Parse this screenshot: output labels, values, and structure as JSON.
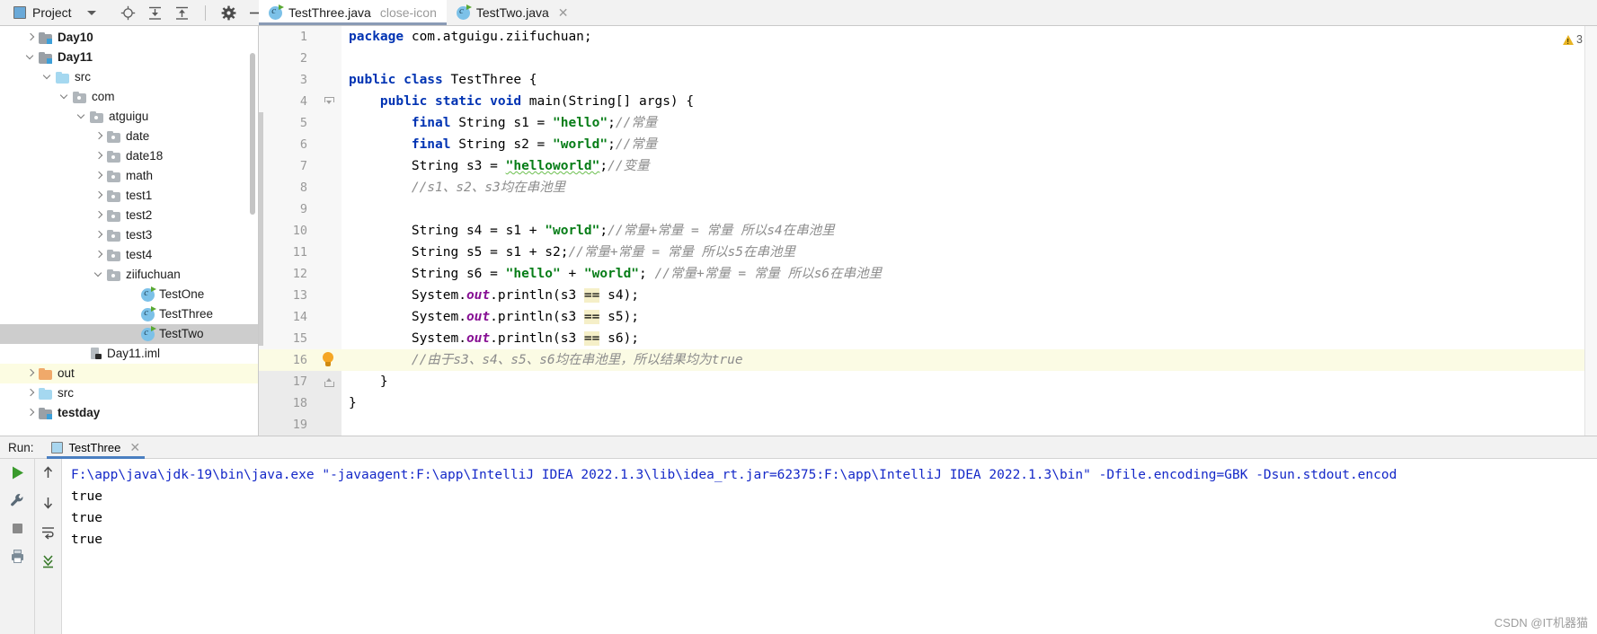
{
  "toolbar": {
    "project_label": "Project",
    "project_icon": "project-panel-icon",
    "dropdown_icon": "chevron-down-icon",
    "icons": [
      {
        "name": "locate-target-icon"
      },
      {
        "name": "expand-all-icon"
      },
      {
        "name": "collapse-all-icon"
      },
      {
        "name": "settings-gear-icon"
      },
      {
        "name": "hide-minimize-icon"
      }
    ]
  },
  "tabs": [
    {
      "label": "TestThree.java",
      "icon": "java-class-icon",
      "active": true,
      "close_icon": "close-icon"
    },
    {
      "label": "TestTwo.java",
      "icon": "java-class-icon",
      "active": false,
      "close_icon": "close-icon"
    }
  ],
  "tree": [
    {
      "label": "Day10",
      "indent": 1,
      "arrow": "right",
      "icon": "module",
      "bold": true,
      "state": "none"
    },
    {
      "label": "Day11",
      "indent": 1,
      "arrow": "down",
      "icon": "module",
      "bold": true,
      "state": "none"
    },
    {
      "label": "src",
      "indent": 2,
      "arrow": "down",
      "icon": "source",
      "bold": false,
      "state": "none"
    },
    {
      "label": "com",
      "indent": 3,
      "arrow": "down",
      "icon": "package",
      "bold": false,
      "state": "none"
    },
    {
      "label": "atguigu",
      "indent": 4,
      "arrow": "down",
      "icon": "package",
      "bold": false,
      "state": "none"
    },
    {
      "label": "date",
      "indent": 5,
      "arrow": "right",
      "icon": "package",
      "bold": false,
      "state": "none"
    },
    {
      "label": "date18",
      "indent": 5,
      "arrow": "right",
      "icon": "package",
      "bold": false,
      "state": "none"
    },
    {
      "label": "math",
      "indent": 5,
      "arrow": "right",
      "icon": "package",
      "bold": false,
      "state": "none"
    },
    {
      "label": "test1",
      "indent": 5,
      "arrow": "right",
      "icon": "package",
      "bold": false,
      "state": "none"
    },
    {
      "label": "test2",
      "indent": 5,
      "arrow": "right",
      "icon": "package",
      "bold": false,
      "state": "none"
    },
    {
      "label": "test3",
      "indent": 5,
      "arrow": "right",
      "icon": "package",
      "bold": false,
      "state": "none"
    },
    {
      "label": "test4",
      "indent": 5,
      "arrow": "right",
      "icon": "package",
      "bold": false,
      "state": "none"
    },
    {
      "label": "ziifuchuan",
      "indent": 5,
      "arrow": "down",
      "icon": "package",
      "bold": false,
      "state": "none"
    },
    {
      "label": "TestOne",
      "indent": 7,
      "arrow": "none",
      "icon": "class",
      "bold": false,
      "state": "none"
    },
    {
      "label": "TestThree",
      "indent": 7,
      "arrow": "none",
      "icon": "class",
      "bold": false,
      "state": "none"
    },
    {
      "label": "TestTwo",
      "indent": 7,
      "arrow": "none",
      "icon": "class",
      "bold": false,
      "state": "selected"
    },
    {
      "label": "Day11.iml",
      "indent": 4,
      "arrow": "none",
      "icon": "iml",
      "bold": false,
      "state": "none"
    },
    {
      "label": "out",
      "indent": 1,
      "arrow": "right",
      "icon": "output",
      "bold": false,
      "state": "highlight"
    },
    {
      "label": "src",
      "indent": 1,
      "arrow": "right",
      "icon": "source",
      "bold": false,
      "state": "none"
    },
    {
      "label": "testday",
      "indent": 1,
      "arrow": "right",
      "icon": "module",
      "bold": true,
      "state": "none"
    }
  ],
  "editor": {
    "warning_count": "3",
    "warning_icon": "warning-triangle-icon",
    "lines": [
      {
        "num": "1",
        "segments": [
          {
            "t": "package ",
            "c": "kw"
          },
          {
            "t": "com.atguigu.ziifuchuan;",
            "c": ""
          }
        ],
        "indent": 0,
        "run": false,
        "fold": "none",
        "bulb": false,
        "highlight": false
      },
      {
        "num": "2",
        "segments": [],
        "indent": 0,
        "run": false,
        "fold": "none",
        "bulb": false,
        "highlight": false
      },
      {
        "num": "3",
        "segments": [
          {
            "t": "public class ",
            "c": "kw"
          },
          {
            "t": "TestThree {",
            "c": ""
          }
        ],
        "indent": 0,
        "run": true,
        "fold": "none",
        "bulb": false,
        "highlight": false
      },
      {
        "num": "4",
        "segments": [
          {
            "t": "    ",
            "c": ""
          },
          {
            "t": "public static void ",
            "c": "kw"
          },
          {
            "t": "main(String[] args) {",
            "c": ""
          }
        ],
        "indent": 0,
        "run": true,
        "fold": "down",
        "bulb": false,
        "highlight": false
      },
      {
        "num": "5",
        "segments": [
          {
            "t": "        ",
            "c": ""
          },
          {
            "t": "final ",
            "c": "kw"
          },
          {
            "t": "String s1 = ",
            "c": ""
          },
          {
            "t": "\"hello\"",
            "c": "str"
          },
          {
            "t": ";",
            "c": ""
          },
          {
            "t": "//常量",
            "c": "cmt"
          }
        ],
        "indent": 0,
        "run": false,
        "fold": "none",
        "bulb": false,
        "highlight": false
      },
      {
        "num": "6",
        "segments": [
          {
            "t": "        ",
            "c": ""
          },
          {
            "t": "final ",
            "c": "kw"
          },
          {
            "t": "String s2 = ",
            "c": ""
          },
          {
            "t": "\"world\"",
            "c": "str"
          },
          {
            "t": ";",
            "c": ""
          },
          {
            "t": "//常量",
            "c": "cmt"
          }
        ],
        "indent": 0,
        "run": false,
        "fold": "none",
        "bulb": false,
        "highlight": false
      },
      {
        "num": "7",
        "segments": [
          {
            "t": "        String s3 = ",
            "c": ""
          },
          {
            "t": "\"helloworld\"",
            "c": "str wavy"
          },
          {
            "t": ";",
            "c": ""
          },
          {
            "t": "//变量",
            "c": "cmt"
          }
        ],
        "indent": 0,
        "run": false,
        "fold": "none",
        "bulb": false,
        "highlight": false
      },
      {
        "num": "8",
        "segments": [
          {
            "t": "        ",
            "c": ""
          },
          {
            "t": "//s1、s2、s3均在串池里",
            "c": "cmt"
          }
        ],
        "indent": 0,
        "run": false,
        "fold": "none",
        "bulb": false,
        "highlight": false
      },
      {
        "num": "9",
        "segments": [],
        "indent": 0,
        "run": false,
        "fold": "none",
        "bulb": false,
        "highlight": false
      },
      {
        "num": "10",
        "segments": [
          {
            "t": "        String s4 = s1 + ",
            "c": ""
          },
          {
            "t": "\"world\"",
            "c": "str"
          },
          {
            "t": ";",
            "c": ""
          },
          {
            "t": "//常量+常量 = 常量 所以s4在串池里",
            "c": "cmt"
          }
        ],
        "indent": 0,
        "run": false,
        "fold": "none",
        "bulb": false,
        "highlight": false
      },
      {
        "num": "11",
        "segments": [
          {
            "t": "        String s5 = s1 + s2;",
            "c": ""
          },
          {
            "t": "//常量+常量 = 常量 所以s5在串池里",
            "c": "cmt"
          }
        ],
        "indent": 0,
        "run": false,
        "fold": "none",
        "bulb": false,
        "highlight": false
      },
      {
        "num": "12",
        "segments": [
          {
            "t": "        String s6 = ",
            "c": ""
          },
          {
            "t": "\"hello\"",
            "c": "str"
          },
          {
            "t": " + ",
            "c": ""
          },
          {
            "t": "\"world\"",
            "c": "str"
          },
          {
            "t": "; ",
            "c": ""
          },
          {
            "t": "//常量+常量 = 常量 所以s6在串池里",
            "c": "cmt"
          }
        ],
        "indent": 0,
        "run": false,
        "fold": "none",
        "bulb": false,
        "highlight": false
      },
      {
        "num": "13",
        "segments": [
          {
            "t": "        System.",
            "c": ""
          },
          {
            "t": "out",
            "c": "fld"
          },
          {
            "t": ".println(s3 ",
            "c": ""
          },
          {
            "t": "==",
            "c": "op-hl"
          },
          {
            "t": " s4);",
            "c": ""
          }
        ],
        "indent": 0,
        "run": false,
        "fold": "none",
        "bulb": false,
        "highlight": false
      },
      {
        "num": "14",
        "segments": [
          {
            "t": "        System.",
            "c": ""
          },
          {
            "t": "out",
            "c": "fld"
          },
          {
            "t": ".println(s3 ",
            "c": ""
          },
          {
            "t": "==",
            "c": "op-hl"
          },
          {
            "t": " s5);",
            "c": ""
          }
        ],
        "indent": 0,
        "run": false,
        "fold": "none",
        "bulb": false,
        "highlight": false
      },
      {
        "num": "15",
        "segments": [
          {
            "t": "        System.",
            "c": ""
          },
          {
            "t": "out",
            "c": "fld"
          },
          {
            "t": ".println(s3 ",
            "c": ""
          },
          {
            "t": "==",
            "c": "op-hl"
          },
          {
            "t": " s6);",
            "c": ""
          }
        ],
        "indent": 0,
        "run": false,
        "fold": "none",
        "bulb": false,
        "highlight": false
      },
      {
        "num": "16",
        "segments": [
          {
            "t": "        ",
            "c": ""
          },
          {
            "t": "//由于s3、s4、s5、s6均在串池里，所以结果均为true",
            "c": "cmt"
          }
        ],
        "indent": 0,
        "run": false,
        "fold": "none",
        "bulb": true,
        "highlight": true
      },
      {
        "num": "17",
        "segments": [
          {
            "t": "    }",
            "c": ""
          }
        ],
        "indent": 0,
        "run": false,
        "fold": "up",
        "bulb": false,
        "highlight": false
      },
      {
        "num": "18",
        "segments": [
          {
            "t": "}",
            "c": ""
          }
        ],
        "indent": 0,
        "run": false,
        "fold": "none",
        "bulb": false,
        "highlight": false
      },
      {
        "num": "19",
        "segments": [],
        "indent": 0,
        "run": false,
        "fold": "none",
        "bulb": false,
        "highlight": false
      }
    ]
  },
  "run_panel": {
    "label": "Run:",
    "tab_label": "TestThree",
    "tab_icon": "run-config-icon",
    "close_icon": "close-icon",
    "gutter_icons": [
      {
        "name": "rerun-play-icon"
      },
      {
        "name": "wrench-settings-icon"
      },
      {
        "name": "stop-square-icon"
      },
      {
        "name": "print-icon"
      }
    ],
    "gutter2_icons": [
      {
        "name": "scroll-up-icon"
      },
      {
        "name": "scroll-down-icon"
      },
      {
        "name": "soft-wrap-icon"
      },
      {
        "name": "scroll-to-end-icon"
      }
    ],
    "console_lines": [
      {
        "text": "F:\\app\\java\\jdk-19\\bin\\java.exe \"-javaagent:F:\\app\\IntelliJ IDEA 2022.1.3\\lib\\idea_rt.jar=62375:F:\\app\\IntelliJ IDEA 2022.1.3\\bin\" -Dfile.encoding=GBK -Dsun.stdout.encod",
        "type": "command"
      },
      {
        "text": "true",
        "type": "output"
      },
      {
        "text": "true",
        "type": "output"
      },
      {
        "text": "true",
        "type": "output"
      }
    ]
  },
  "watermark": "CSDN @IT机器猫"
}
